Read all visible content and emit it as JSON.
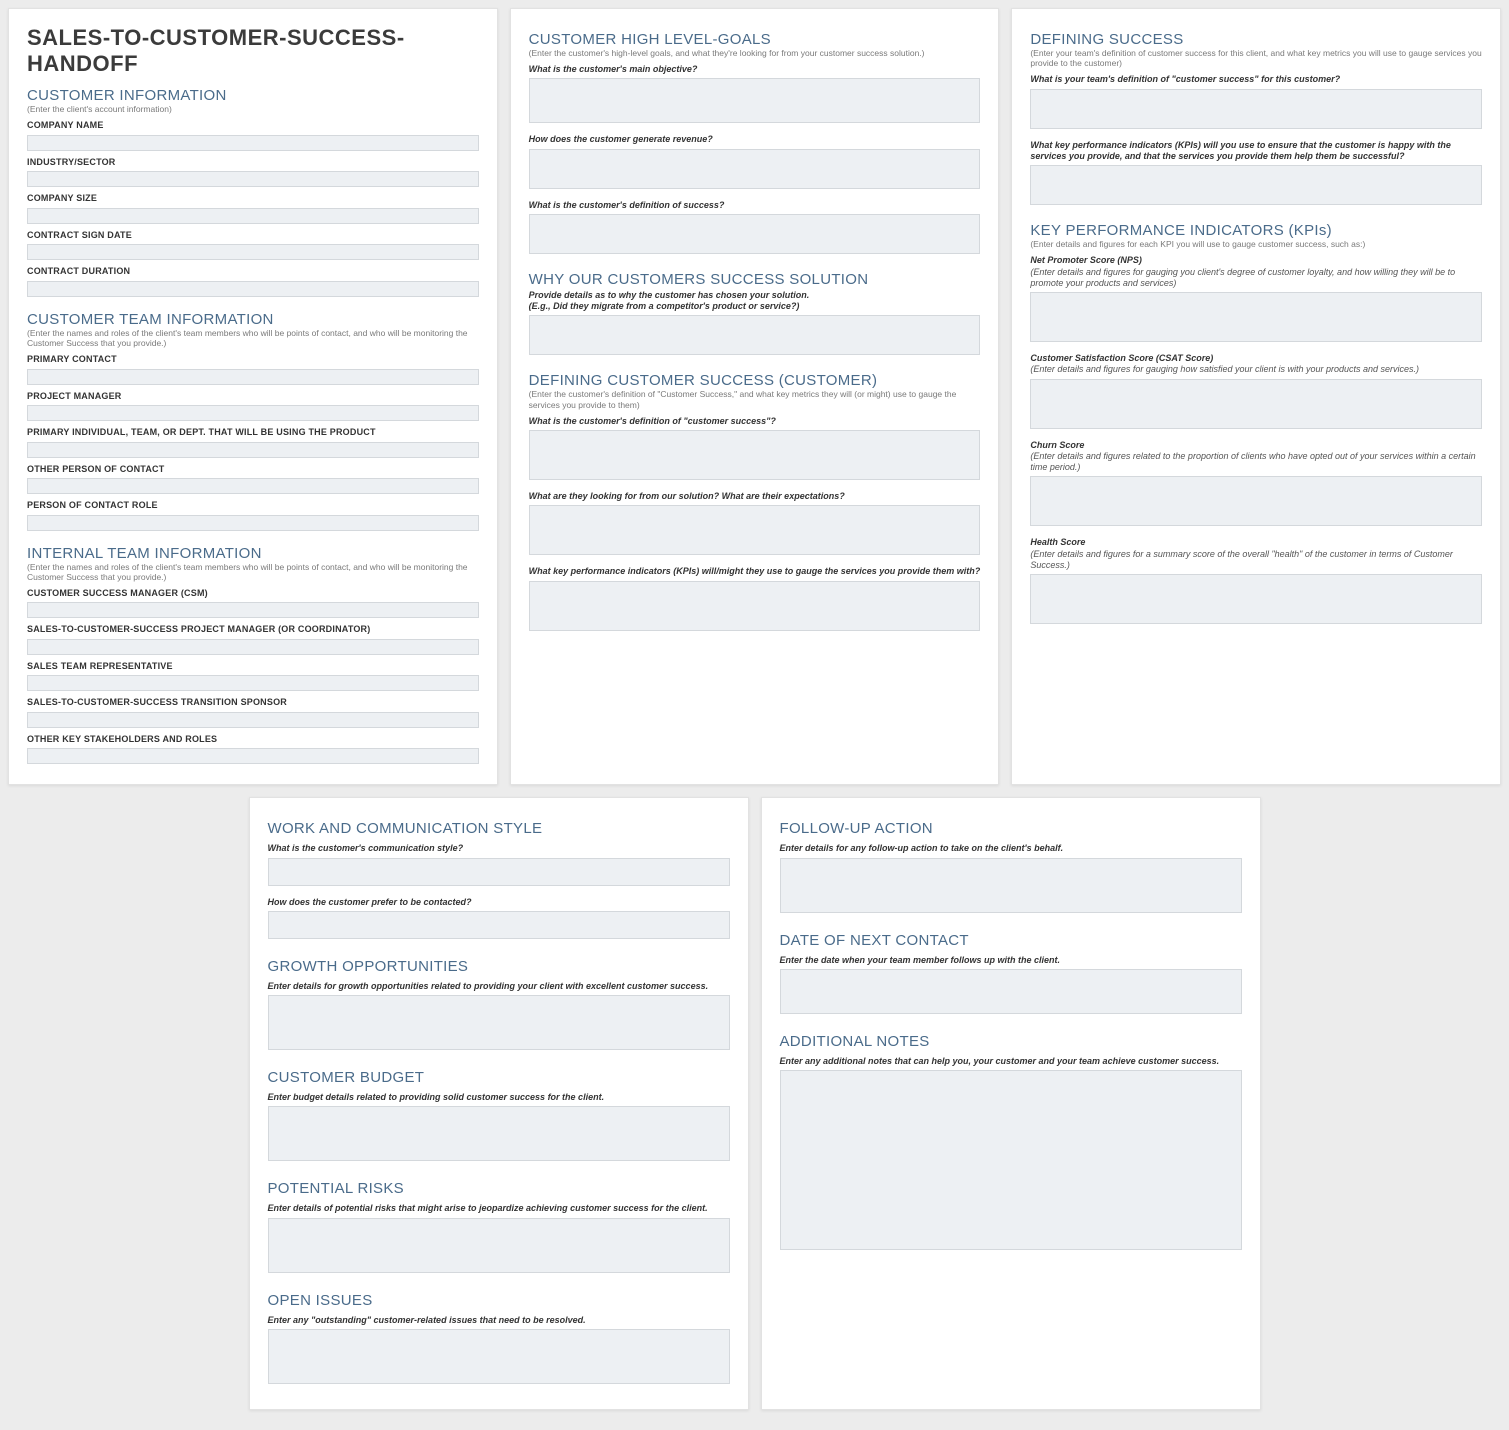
{
  "doc_title": "SALES-TO-CUSTOMER-SUCCESS-HANDOFF",
  "card1": {
    "s1": {
      "heading": "CUSTOMER INFORMATION",
      "sub": "(Enter the client's account information)",
      "f": [
        "COMPANY NAME",
        "INDUSTRY/SECTOR",
        "COMPANY SIZE",
        "CONTRACT SIGN DATE",
        "CONTRACT DURATION"
      ]
    },
    "s2": {
      "heading": "CUSTOMER TEAM INFORMATION",
      "sub": "(Enter the names and roles of the client's team members who will be points of contact, and who will be monitoring the Customer Success that you provide.)",
      "f": [
        "PRIMARY CONTACT",
        "PROJECT MANAGER",
        "PRIMARY INDIVIDUAL, TEAM, OR DEPT. THAT WILL BE USING THE PRODUCT",
        "OTHER PERSON OF CONTACT",
        "PERSON OF CONTACT ROLE"
      ]
    },
    "s3": {
      "heading": "INTERNAL TEAM INFORMATION",
      "sub": "(Enter the names and roles of the client's team members who will be points of contact, and who will be monitoring the Customer Success that you provide.)",
      "f": [
        "CUSTOMER SUCCESS MANAGER (CSM)",
        "SALES-TO-CUSTOMER-SUCCESS PROJECT MANAGER (OR COORDINATOR)",
        "SALES TEAM REPRESENTATIVE",
        "SALES-TO-CUSTOMER-SUCCESS TRANSITION SPONSOR",
        "OTHER KEY STAKEHOLDERS AND ROLES"
      ]
    }
  },
  "card2": {
    "s1": {
      "heading": "CUSTOMER HIGH LEVEL-GOALS",
      "sub": "(Enter the customer's high-level goals, and what they're looking for from your customer success solution.)",
      "q": [
        "What is the customer's main objective?",
        "How does the customer generate revenue?",
        "What is the customer's definition of success?"
      ]
    },
    "s2": {
      "heading": "WHY OUR CUSTOMERS SUCCESS SOLUTION",
      "q": [
        "Provide details as to why the customer has chosen your solution.\n(E.g., Did they migrate from a competitor's product or service?)"
      ]
    },
    "s3": {
      "heading": "DEFINING CUSTOMER SUCCESS (CUSTOMER)",
      "sub": "(Enter the customer's definition of \"Customer Success,\" and what key metrics they will (or might) use to gauge the services you provide to them)",
      "q": [
        "What is the customer's definition of \"customer success\"?",
        "What are they looking for from our solution? What are their expectations?",
        "What key performance indicators (KPIs) will/might they use to gauge the services you provide them with?"
      ]
    }
  },
  "card3": {
    "s1": {
      "heading": "DEFINING SUCCESS",
      "sub": "(Enter your team's definition of customer success for this client, and what key metrics you will use to gauge services you provide to the customer)",
      "q": [
        "What is your team's definition of \"customer success\" for this customer?",
        "What key performance indicators (KPIs) will you use to ensure that the customer is happy with the services you provide, and that the services you provide them help them be successful?"
      ]
    },
    "s2": {
      "heading": "KEY PERFORMANCE INDICATORS (KPIs)",
      "sub": "(Enter details and figures for each KPI you will use to gauge customer success, such as:)",
      "items": [
        {
          "title": "Net Promoter Score (NPS)",
          "desc": "(Enter details and figures for gauging you client's degree of customer loyalty, and how willing they will be to promote your products and services)"
        },
        {
          "title": "Customer Satisfaction Score (CSAT Score)",
          "desc": "(Enter details and figures for gauging how satisfied your client is with your products and services.)"
        },
        {
          "title": "Churn Score",
          "desc": "(Enter details and figures related to the proportion of clients who have opted out of your services within a certain time period.)"
        },
        {
          "title": "Health Score",
          "desc": "(Enter details and figures for a summary score of the overall \"health\" of the customer in terms of Customer Success.)"
        }
      ]
    }
  },
  "card4": {
    "s1": {
      "heading": "WORK AND COMMUNICATION STYLE",
      "q": [
        "What is the customer's communication style?",
        "How does the customer prefer to be contacted?"
      ]
    },
    "s2": {
      "heading": "GROWTH OPPORTUNITIES",
      "q": [
        "Enter details for growth opportunities related to providing your client with excellent customer success."
      ]
    },
    "s3": {
      "heading": "CUSTOMER BUDGET",
      "q": [
        "Enter budget details related to providing solid customer success for the client."
      ]
    },
    "s4": {
      "heading": "POTENTIAL RISKS",
      "q": [
        "Enter details of potential risks that might arise to jeopardize achieving customer success for the client."
      ]
    },
    "s5": {
      "heading": "OPEN ISSUES",
      "q": [
        "Enter any \"outstanding\" customer-related issues that need to be resolved."
      ]
    }
  },
  "card5": {
    "s1": {
      "heading": "FOLLOW-UP ACTION",
      "q": [
        "Enter details for any follow-up action to take on the client's behalf."
      ]
    },
    "s2": {
      "heading": "DATE OF NEXT CONTACT",
      "q": [
        "Enter the date when your team member follows up with the client."
      ]
    },
    "s3": {
      "heading": "ADDITIONAL NOTES",
      "q": [
        "Enter any additional notes that can help you, your customer and your team achieve customer success."
      ]
    }
  }
}
